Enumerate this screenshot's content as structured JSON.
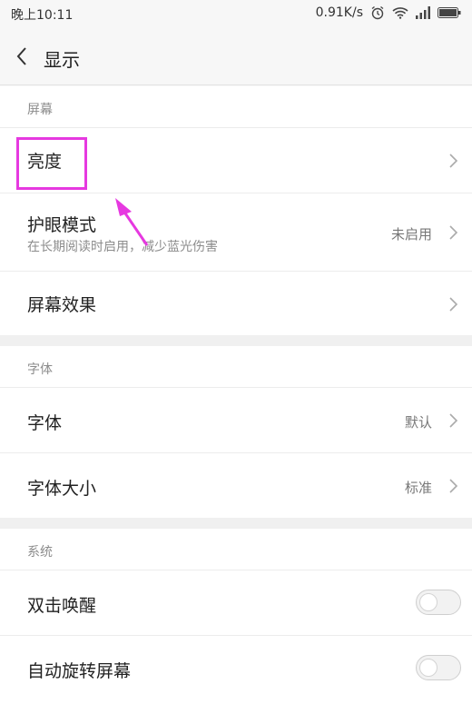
{
  "status_bar": {
    "time": "晚上10:11",
    "speed": "0.91K/s"
  },
  "header": {
    "title": "显示",
    "back_icon": "back-chevron-icon"
  },
  "sections": {
    "screen": {
      "title": "屏幕",
      "items": [
        {
          "label": "亮度"
        },
        {
          "label": "护眼模式",
          "subtitle": "在长期阅读时启用，减少蓝光伤害",
          "value": "未启用"
        },
        {
          "label": "屏幕效果"
        }
      ]
    },
    "font": {
      "title": "字体",
      "items": [
        {
          "label": "字体",
          "value": "默认"
        },
        {
          "label": "字体大小",
          "value": "标准"
        }
      ]
    },
    "system": {
      "title": "系统",
      "items": [
        {
          "label": "双击唤醒",
          "toggle": false
        },
        {
          "label": "自动旋转屏幕",
          "toggle": false
        }
      ]
    }
  },
  "annotation": {
    "color": "#e639e0"
  }
}
